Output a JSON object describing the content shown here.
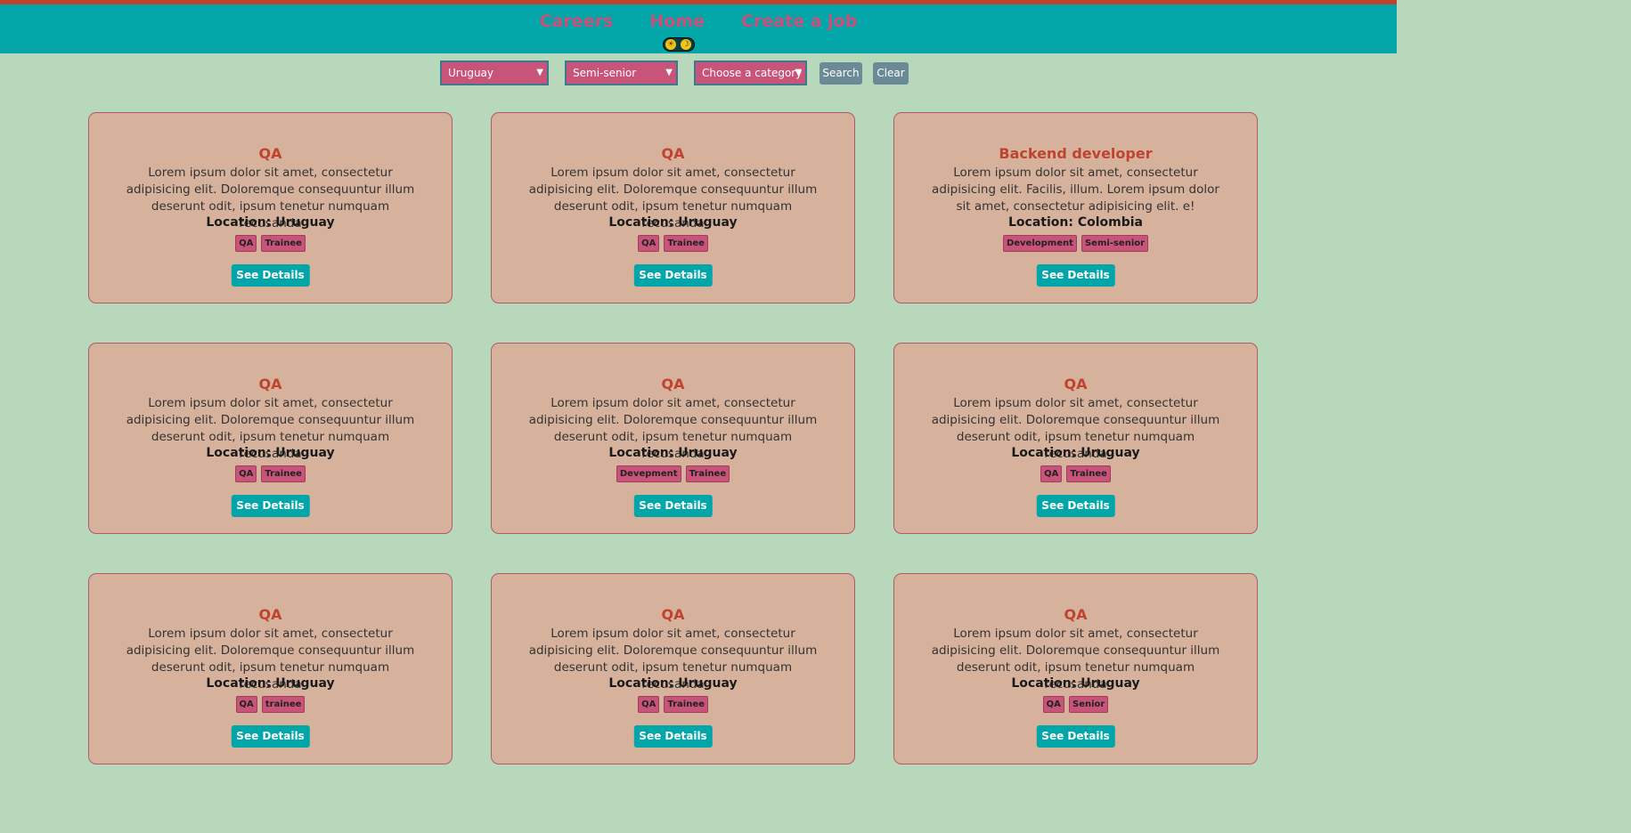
{
  "nav": {
    "links": [
      "Careers",
      "Home",
      "Create a job"
    ]
  },
  "theme_toggle": {
    "sun": "☀",
    "moon": "☽"
  },
  "filters": {
    "country": "Uruguay",
    "seniority": "Semi-senior",
    "category": "Choose a category",
    "search_label": "Search",
    "clear_label": "Clear"
  },
  "cards": [
    {
      "title": "QA",
      "desc": "Lorem ipsum dolor sit amet, consectetur adipisicing elit. Doloremque consequuntur illum deserunt odit, ipsum tenetur numquam recusanda",
      "location": "Location: Uruguay",
      "tags": [
        "QA",
        "Trainee"
      ],
      "button": "See Details"
    },
    {
      "title": "QA",
      "desc": "Lorem ipsum dolor sit amet, consectetur adipisicing elit. Doloremque consequuntur illum deserunt odit, ipsum tenetur numquam recusanda",
      "location": "Location: Uruguay",
      "tags": [
        "QA",
        "Trainee"
      ],
      "button": "See Details"
    },
    {
      "title": "Backend developer",
      "desc": "Lorem ipsum dolor sit amet, consectetur adipisicing elit. Facilis, illum. Lorem ipsum dolor sit amet, consectetur adipisicing elit. e!",
      "location": "Location: Colombia",
      "tags": [
        "Development",
        "Semi-senior"
      ],
      "button": "See Details"
    },
    {
      "title": "QA",
      "desc": "Lorem ipsum dolor sit amet, consectetur adipisicing elit. Doloremque consequuntur illum deserunt odit, ipsum tenetur numquam recusanda",
      "location": "Location: Uruguay",
      "tags": [
        "QA",
        "Trainee"
      ],
      "button": "See Details"
    },
    {
      "title": "QA",
      "desc": "Lorem ipsum dolor sit amet, consectetur adipisicing elit. Doloremque consequuntur illum deserunt odit, ipsum tenetur numquam recusanda",
      "location": "Location: Uruguay",
      "tags": [
        "Devepment",
        "Trainee"
      ],
      "button": "See Details"
    },
    {
      "title": "QA",
      "desc": "Lorem ipsum dolor sit amet, consectetur adipisicing elit. Doloremque consequuntur illum deserunt odit, ipsum tenetur numquam recusanda",
      "location": "Location: Uruguay",
      "tags": [
        "QA",
        "Trainee"
      ],
      "button": "See Details"
    },
    {
      "title": "QA",
      "desc": "Lorem ipsum dolor sit amet, consectetur adipisicing elit. Doloremque consequuntur illum deserunt odit, ipsum tenetur numquam recusanda",
      "location": "Location: Uruguay",
      "tags": [
        "QA",
        "trainee"
      ],
      "button": "See Details"
    },
    {
      "title": "QA",
      "desc": "Lorem ipsum dolor sit amet, consectetur adipisicing elit. Doloremque consequuntur illum deserunt odit, ipsum tenetur numquam recusanda",
      "location": "Location: Uruguay",
      "tags": [
        "QA",
        "Trainee"
      ],
      "button": "See Details"
    },
    {
      "title": "QA",
      "desc": "Lorem ipsum dolor sit amet, consectetur adipisicing elit. Doloremque consequuntur illum deserunt odit, ipsum tenetur numquam recusanda",
      "location": "Location: Uruguay",
      "tags": [
        "QA",
        "Senior"
      ],
      "button": "See Details"
    }
  ]
}
